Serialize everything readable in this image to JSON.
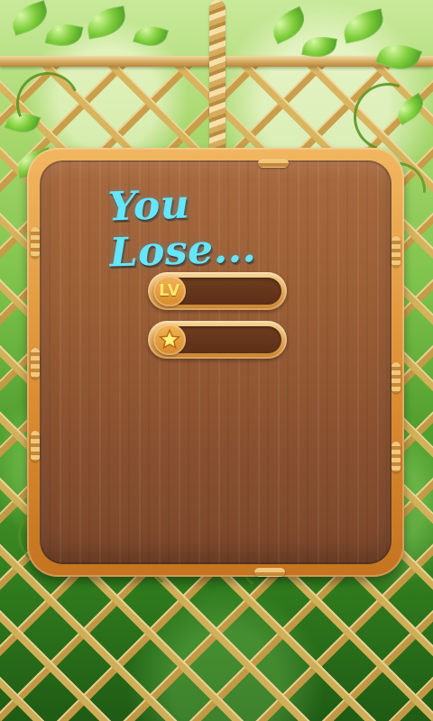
{
  "screen": {
    "title": "You Lose...",
    "lv_badge": "LV"
  },
  "bars": {
    "level": {
      "fill_fraction": 0
    },
    "stars": {
      "fill_fraction": 0
    }
  },
  "icons": {
    "level_badge": "lv-badge-icon",
    "stars_badge": "star-icon"
  },
  "colors": {
    "title": "#65e6ff",
    "board_wood": "#9b5f36",
    "frame_orange": "#dd8f33",
    "bar_track": "#5b2f17",
    "badge_text": "#ffe76a"
  }
}
